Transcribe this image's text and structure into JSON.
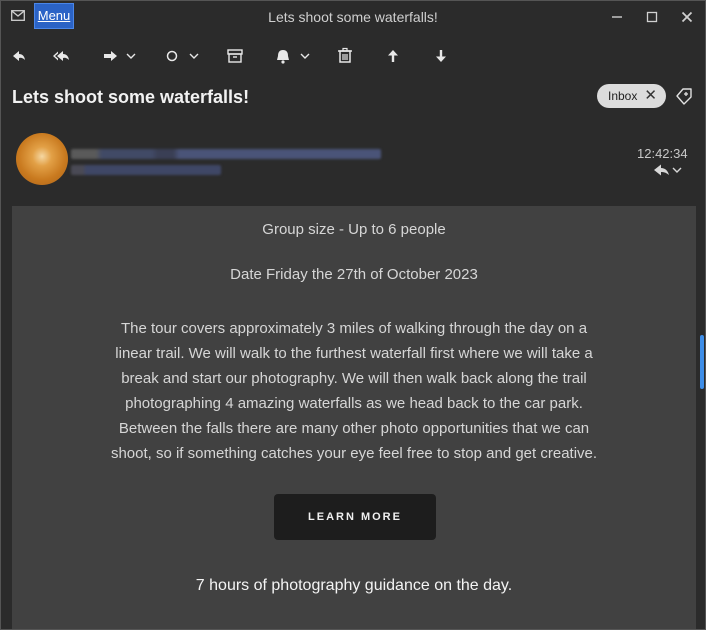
{
  "window": {
    "title": "Lets shoot some waterfalls!",
    "menu_label": "Menu"
  },
  "toolbar": {
    "icons": [
      "reply-icon",
      "reply-all-icon",
      "forward-icon",
      "mark-read-icon",
      "archive-icon",
      "reminder-icon",
      "delete-icon",
      "previous-icon",
      "next-icon"
    ]
  },
  "message": {
    "subject": "Lets shoot some waterfalls!",
    "folder_chip": "Inbox",
    "chip_close": "✕",
    "time": "12:42:34"
  },
  "body": {
    "group_size": "Group size - Up to 6 people",
    "date": "Date Friday the 27th of October 2023",
    "paragraph_lines": [
      "The tour covers approximately 3 miles of walking through the day on a",
      "linear trail. We will walk to the furthest waterfall first where we will take a",
      "break and start our photography. We will then walk back along the trail",
      "photographing 4 amazing waterfalls as we head back to the car park.",
      "Between the falls there are many other photo opportunities that we can",
      "shoot, so if something catches your eye feel free to stop and get creative."
    ],
    "cta_label": "LEARN MORE",
    "guidance": "7 hours of photography guidance on the day."
  },
  "colors": {
    "accent": "#2b63c6",
    "scroll_thumb": "#3e8ee8",
    "body_bg": "#414141",
    "chrome_bg": "#2b2b2b"
  }
}
